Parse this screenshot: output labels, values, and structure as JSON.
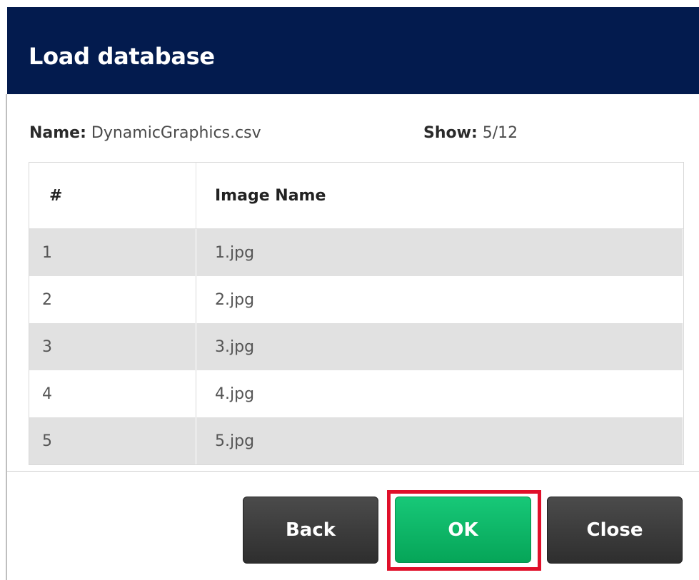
{
  "dialog": {
    "title": "Load database"
  },
  "meta": {
    "name_label": "Name:",
    "name_value": "DynamicGraphics.csv",
    "show_label": "Show:",
    "show_value": "5/12"
  },
  "table": {
    "headers": [
      "#",
      "Image Name"
    ],
    "rows": [
      {
        "num": "1",
        "name": "1.jpg"
      },
      {
        "num": "2",
        "name": "2.jpg"
      },
      {
        "num": "3",
        "name": "3.jpg"
      },
      {
        "num": "4",
        "name": "4.jpg"
      },
      {
        "num": "5",
        "name": "5.jpg"
      }
    ]
  },
  "buttons": {
    "back": "Back",
    "ok": "OK",
    "close": "Close"
  },
  "colors": {
    "titlebar": "#031b4e",
    "ok_button": "#0bb563",
    "highlight": "#e0102a",
    "dark_button": "#3a3a3a"
  }
}
